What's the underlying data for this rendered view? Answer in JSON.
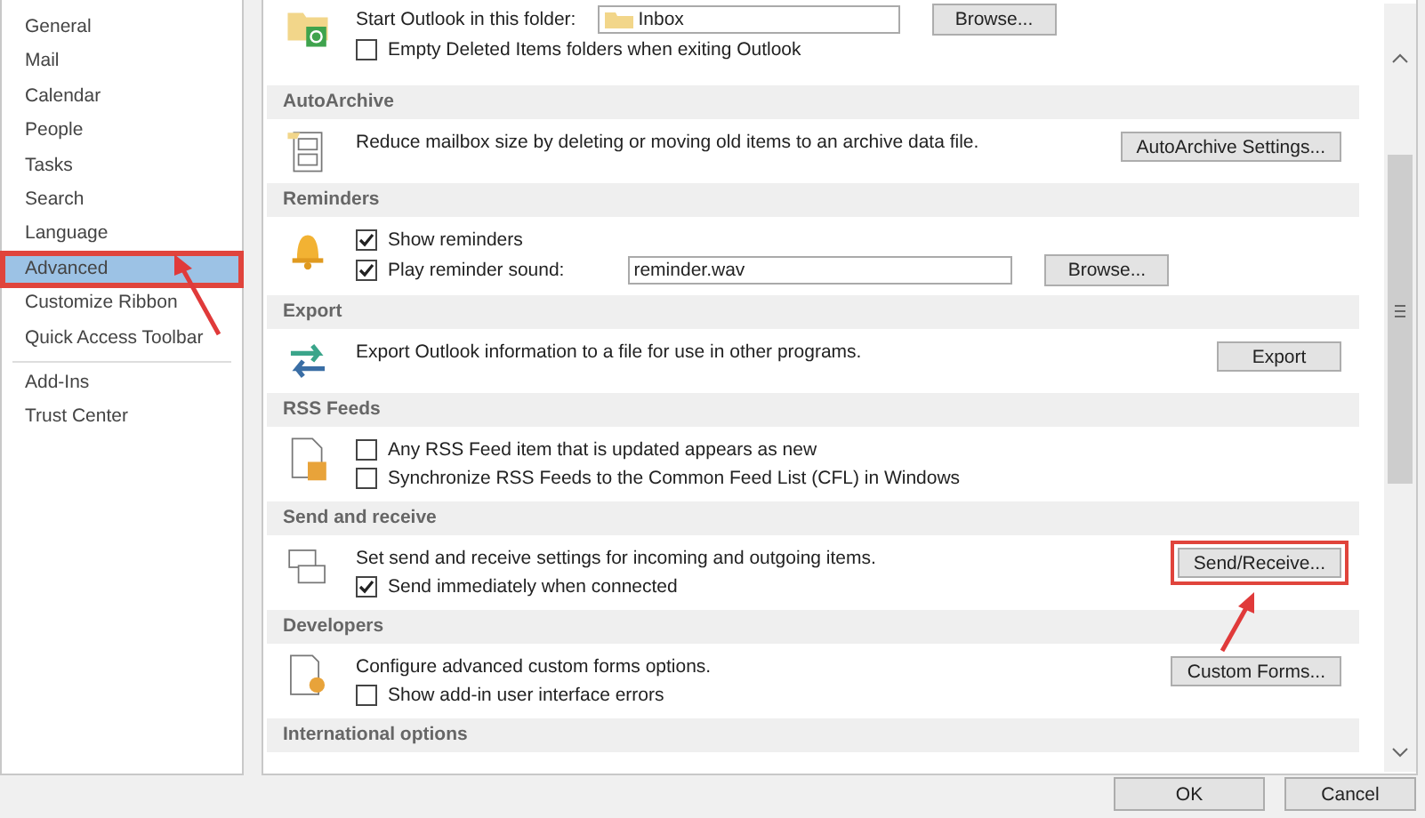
{
  "sidebar": {
    "items": [
      {
        "label": "General",
        "selected": false,
        "annotated": false
      },
      {
        "label": "Mail",
        "selected": false,
        "annotated": false
      },
      {
        "label": "Calendar",
        "selected": false,
        "annotated": false
      },
      {
        "label": "People",
        "selected": false,
        "annotated": false
      },
      {
        "label": "Tasks",
        "selected": false,
        "annotated": false
      },
      {
        "label": "Search",
        "selected": false,
        "annotated": false
      },
      {
        "label": "Language",
        "selected": false,
        "annotated": false
      },
      {
        "label": "Advanced",
        "selected": true,
        "annotated": true
      },
      {
        "label": "Customize Ribbon",
        "selected": false,
        "annotated": false
      },
      {
        "label": "Quick Access Toolbar",
        "selected": false,
        "annotated": false
      },
      {
        "label": "Add-Ins",
        "selected": false,
        "annotated": false,
        "group_start": true
      },
      {
        "label": "Trust Center",
        "selected": false,
        "annotated": false
      }
    ]
  },
  "sections": [
    {
      "rows": [
        {
          "kind": "field",
          "label": "Start Outlook in this folder:",
          "value": "Inbox",
          "button": "Browse..."
        },
        {
          "kind": "checkbox",
          "label": "Empty Deleted Items folders when exiting Outlook",
          "checked": false
        }
      ]
    },
    {
      "title": "AutoArchive",
      "rows": [
        {
          "kind": "text",
          "label": "Reduce mailbox size by deleting or moving old items to an archive data file."
        }
      ],
      "button": {
        "label": "AutoArchive Settings...",
        "annotated": false
      }
    },
    {
      "title": "Reminders",
      "rows": [
        {
          "kind": "checkbox",
          "label": "Show reminders",
          "checked": true
        },
        {
          "kind": "checkfield",
          "label": "Play reminder sound:",
          "checked": true,
          "value": "reminder.wav",
          "button": "Browse..."
        }
      ]
    },
    {
      "title": "Export",
      "rows": [
        {
          "kind": "text",
          "label": "Export Outlook information to a file for use in other programs."
        }
      ],
      "button": {
        "label": "Export",
        "annotated": false
      }
    },
    {
      "title": "RSS Feeds",
      "rows": [
        {
          "kind": "checkbox",
          "label": "Any RSS Feed item that is updated appears as new",
          "checked": false
        },
        {
          "kind": "checkbox",
          "label": "Synchronize RSS Feeds to the Common Feed List (CFL) in Windows",
          "checked": false
        }
      ]
    },
    {
      "title": "Send and receive",
      "rows": [
        {
          "kind": "text",
          "label": "Set send and receive settings for incoming and outgoing items."
        },
        {
          "kind": "checkbox",
          "label": "Send immediately when connected",
          "checked": true
        }
      ],
      "button": {
        "label": "Send/Receive...",
        "annotated": true
      }
    },
    {
      "title": "Developers",
      "rows": [
        {
          "kind": "text",
          "label": "Configure advanced custom forms options."
        },
        {
          "kind": "checkbox",
          "label": "Show add-in user interface errors",
          "checked": false
        }
      ],
      "button": {
        "label": "Custom Forms...",
        "annotated": false
      }
    },
    {
      "title": "International options"
    }
  ],
  "buttons": [
    "OK",
    "Cancel"
  ]
}
